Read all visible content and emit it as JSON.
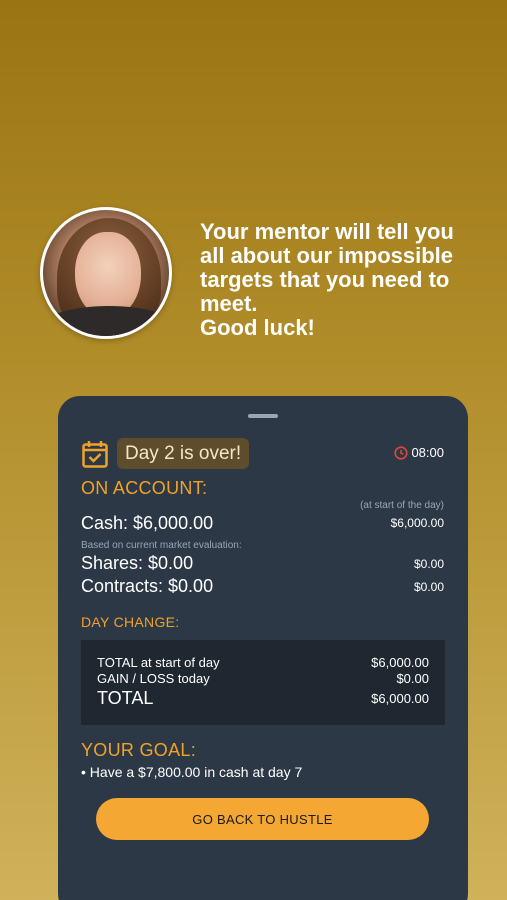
{
  "mentor": {
    "message": "Your mentor will tell you\nall about our impossible\ntargets that you need to\nmeet.\nGood luck!"
  },
  "card": {
    "day_badge": "Day 2 is over!",
    "timer": "08:00",
    "on_account": {
      "title": "ON ACCOUNT:",
      "start_of_day_note": "(at start of the day)",
      "cash_label": "Cash: $6,000.00",
      "cash_start": "$6,000.00",
      "evaluation_note": "Based on current market evaluation:",
      "shares_label": "Shares: $0.00",
      "shares_start": "$0.00",
      "contracts_label": "Contracts: $0.00",
      "contracts_start": "$0.00"
    },
    "day_change": {
      "title": "DAY CHANGE:",
      "rows": [
        {
          "label": "TOTAL at start of day",
          "value": "$6,000.00"
        },
        {
          "label": "GAIN / LOSS today",
          "value": "$0.00"
        },
        {
          "label": "TOTAL",
          "value": "$6,000.00"
        }
      ]
    },
    "goal": {
      "title": "YOUR GOAL:",
      "item": "• Have a $7,800.00 in cash at day 7"
    },
    "cta_label": "GO BACK TO HUSTLE"
  },
  "colors": {
    "accent": "#f0a32a",
    "card_bg": "#2c3846",
    "cta_bg": "#f4a733"
  }
}
